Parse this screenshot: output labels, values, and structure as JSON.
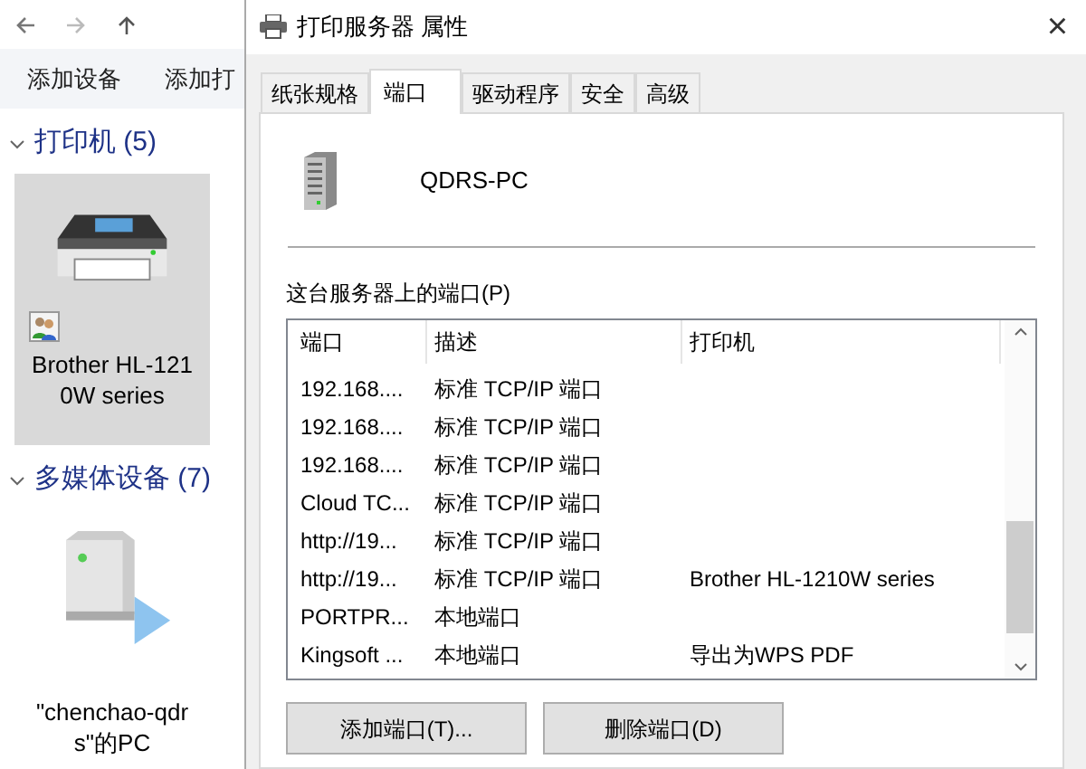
{
  "explorer": {
    "toolbar": [
      "添加设备",
      "添加打"
    ],
    "groups": [
      {
        "title": "打印机 (5)",
        "expanded": true,
        "items": [
          {
            "name": "Brother HL-1210W series",
            "kind": "printer",
            "selected": true,
            "shared": true
          }
        ]
      },
      {
        "title": "多媒体设备 (7)",
        "expanded": true,
        "items": [
          {
            "name": "\"chenchao-qdrs\"的PC",
            "kind": "media",
            "selected": false,
            "shared": false
          }
        ]
      }
    ]
  },
  "dialog": {
    "title": "打印服务器 属性",
    "close": "×",
    "tabs": [
      {
        "label": "纸张规格",
        "selected": false
      },
      {
        "label": "端口",
        "selected": true
      },
      {
        "label": "驱动程序",
        "selected": false
      },
      {
        "label": "安全",
        "selected": false
      },
      {
        "label": "高级",
        "selected": false
      }
    ],
    "server_name": "QDRS-PC",
    "ports_label": "这台服务器上的端口(P)",
    "columns": [
      "端口",
      "描述",
      "打印机"
    ],
    "rows": [
      [
        "192.168....",
        "标准 TCP/IP 端口",
        ""
      ],
      [
        "192.168....",
        "标准 TCP/IP 端口",
        ""
      ],
      [
        "192.168....",
        "标准 TCP/IP 端口",
        ""
      ],
      [
        "Cloud TC...",
        "标准 TCP/IP 端口",
        ""
      ],
      [
        "http://19...",
        "标准 TCP/IP 端口",
        ""
      ],
      [
        "http://19...",
        "标准 TCP/IP 端口",
        "Brother HL-1210W series"
      ],
      [
        "PORTPR...",
        "本地端口",
        ""
      ],
      [
        "Kingsoft ...",
        "本地端口",
        "导出为WPS PDF"
      ]
    ],
    "buttons": [
      "添加端口(T)...",
      "删除端口(D)"
    ]
  }
}
